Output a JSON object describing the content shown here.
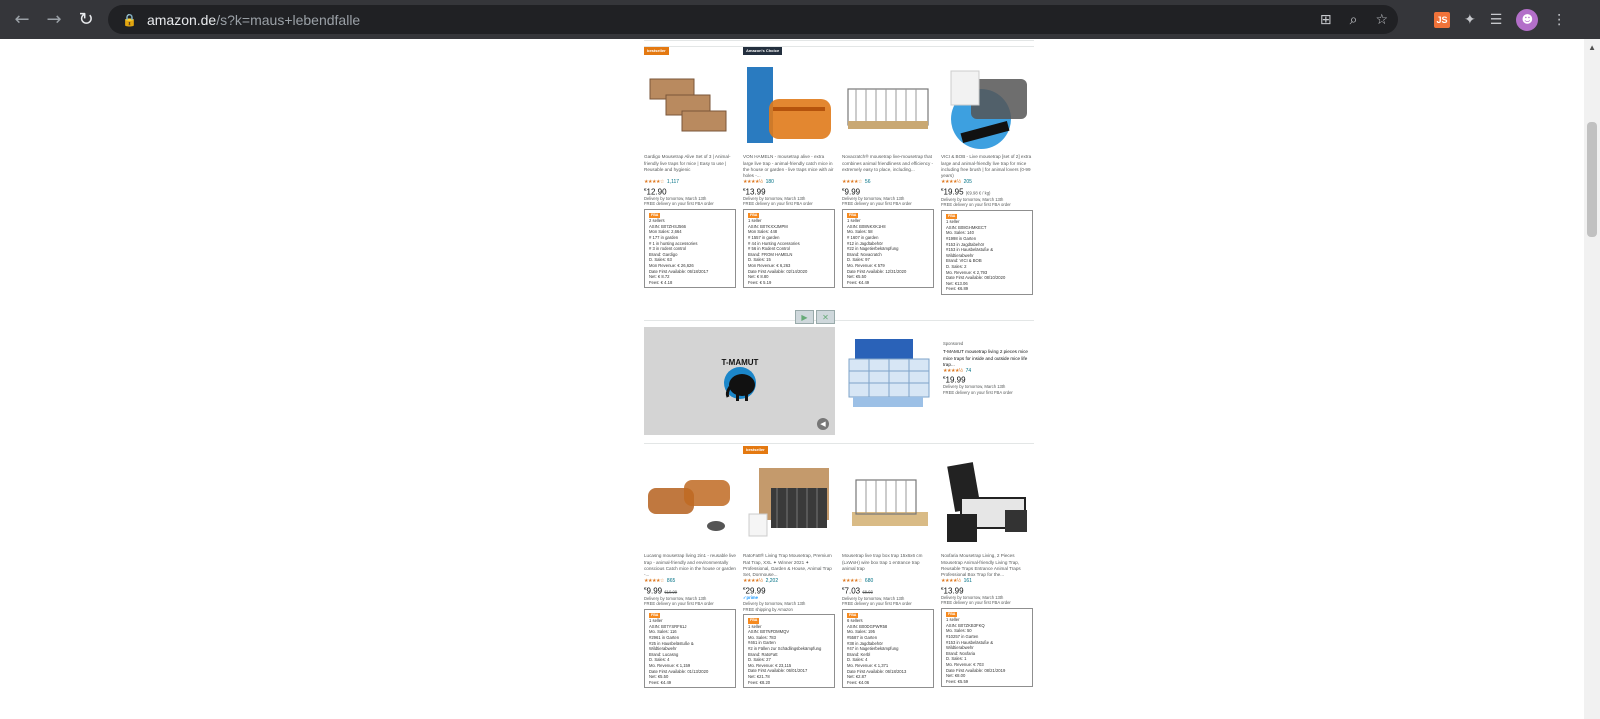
{
  "browser": {
    "url_host": "amazon.de",
    "url_rest": "/s?k=maus+lebendfalle",
    "ext_js_label": "JS"
  },
  "row1": [
    {
      "badge": "bestseller",
      "title": "Gardigo Mousetrap Alive Set of 3 | Animal-friendly live traps for mice | Easy to use | Reusable and hygienic",
      "stars": "★★★★☆",
      "rating_count": "1,117",
      "price": "12.90",
      "delivery": "Delivery by tomorrow, March 13th",
      "delivery2": "FREE delivery on your first FBA order",
      "info_tag": "FBA",
      "info": [
        "2 sellers",
        "ASIN: B07ZHSJ566",
        "Mon Sales: 2,664",
        "# 177 in garden",
        "# 1 in hunting accessories",
        "# 3 in rodent control",
        "Brand: Gardigo",
        "D. Sales: 63",
        "Mon Revenue: € 26,626",
        "Date First Available: 06/18/2017",
        "Net: € 8.72",
        "Fees: € 4.18"
      ]
    },
    {
      "badge": "Amazon's Choice",
      "title": "VON HAMELN - mousetrap alive - extra large live trap - animal-friendly catch mice in the house or garden - live traps mice with air holes -...",
      "stars": "★★★★½",
      "rating_count": "180",
      "price": "13.99",
      "delivery": "Delivery by tomorrow, March 13th",
      "delivery2": "FREE delivery on your first FBA order",
      "info_tag": "FBA",
      "info": [
        "1 seller",
        "ASIN: B07KXXJMPM",
        "Mon Sales: 448",
        "# 1557 in garden",
        "# 44 in Hunting Accessories",
        "# 56 in Rodent Control",
        "Brand: FROM HAMELN",
        "D. Sales: 15",
        "Mon Revenue: € 6,263",
        "Date First Available: 02/14/2020",
        "Net: € 8.80",
        "Fees: € 5.19"
      ]
    },
    {
      "badge": "",
      "title": "Novacratch® mousetrap live-mousetrap that combines animal friendliness and efficiency - extremely easy to place, including...",
      "stars": "★★★★☆",
      "rating_count": "56",
      "price": "9.99",
      "delivery": "Delivery by tomorrow, March 13th",
      "delivery2": "FREE delivery on your first FBA order",
      "info_tag": "FBA",
      "info": [
        "1 seller",
        "ASIN: B08NKXK1H8",
        "Mo. Sales: 58",
        "# 1607 in garden",
        "#12 in Jagdtabehör",
        "#22 in Nagetierbekämpfung",
        "Brand: Novacratch",
        "D. Sales: 97",
        "Mo. Revenue: € 579",
        "Date First Available: 12/31/2020",
        "Net: €5.50",
        "Fees: €4.49"
      ]
    },
    {
      "badge": "",
      "title": "VICI & BOB - Live mousetrap [set of 2] extra large and animal-friendly live trap for mice including free brush | for animal lovers (0-99 years)",
      "stars": "★★★★½",
      "rating_count": "205",
      "price": "19.95",
      "price_unit": "(€9.98 € / kg)",
      "delivery": "Delivery by tomorrow, March 13th",
      "delivery2": "FREE delivery on your first FBA order",
      "info_tag": "FBA",
      "info": [
        "1 seller",
        "ASIN: B08GHMKECT",
        "Mo. Sales: 140",
        "#1998 in Garten",
        "#153 in Jagdtabehör",
        "#153 in Hausbelästuße &",
        "Wildtierabwehr",
        "Brand: VICI & BOB",
        "D. Sales: 2",
        "Mo. Revenue: € 2,793",
        "Date First Available: 08/10/2020",
        "Net: €13.06",
        "Fees: €6.89"
      ]
    }
  ],
  "sponsored": {
    "brand_logo": "T-MAMUT",
    "label": "Sponsored",
    "title": "T-MAMUT mousetrap living 2 pieces mice mice traps for inside and outside mice life trap...",
    "stars": "★★★★½",
    "rating_count": "74",
    "price": "19.99",
    "delivery": "Delivery by tomorrow, March 13th",
    "delivery2": "FREE delivery on your first FBA order"
  },
  "row2": [
    {
      "badge": "",
      "title": "Lucasng mousetrap living 2in1 - reusable live trap - animal-friendly and environmentally conscious Catch mice in the house or garden -...",
      "stars": "★★★★☆",
      "rating_count": "865",
      "price": "9.99",
      "price_old": "€10.99",
      "delivery": "Delivery by tomorrow, March 13th",
      "delivery2": "FREE delivery on your first FBA order",
      "info_tag": "FBA",
      "info": [
        "1 seller",
        "ASIN: B07YSRF61J",
        "Mo. Sales: 116",
        "#2961 in Garten",
        "#25 in Hausbelästuße &",
        "Wildtierabwehr",
        "Brand: Lucasng",
        "D. Sales: 4",
        "Mo. Revenue: € 1,159",
        "Date First Available: 01/13/2020",
        "Net: €5.50",
        "Fees: €4.49"
      ]
    },
    {
      "badge": "bestseller",
      "title": "RatoFatt® Living Trap Mousetrap, Premium Rat Trap, XXL ✦ Winner 2021 ✦ Professional, Garden & House, Animal Trap Set, Dormouse...",
      "stars": "★★★★½",
      "rating_count": "2,202",
      "price": "29.99",
      "prime": "✓prime",
      "delivery": "Delivery by tomorrow, March 13th",
      "delivery2": "FREE shipping by Amazon",
      "info_tag": "FBA",
      "info": [
        "1 seller",
        "ASIN: B07NFDMMQV",
        "Mo. Sales: 783",
        "#461 in Garten",
        "#2 in Fällen zur Schädlingsbekämpfung",
        "Brand: RatoFatt",
        "D. Sales: 27",
        "Mo. Revenue: € 23,115",
        "Date First Available: 06/01/2017",
        "Net: €21.78",
        "Fees: €8.20"
      ]
    },
    {
      "badge": "",
      "title": "Mousetrap live trap box trap 15x6x6 cm (LxWxH) wire box trap 1 entrance trap animal trap",
      "stars": "★★★★☆",
      "rating_count": "680",
      "price": "7.03",
      "price_old": "€8.03",
      "delivery": "Delivery by tomorrow, March 13th",
      "delivery2": "FREE delivery on your first FBA order",
      "info_tag": "FBA",
      "info": [
        "6 sellers",
        "ASIN: B00DGPWR58",
        "Mo. Sales: 195",
        "#5587 in Garten",
        "#38 in Jagdtabehör",
        "#47 in Nagetierbekämpfung",
        "Brand: Kerbl",
        "D. Sales: 4",
        "Mo. Revenue: € 1,371",
        "Date First Available: 06/18/2013",
        "Net: €2.87",
        "Fees: €4.06"
      ]
    },
    {
      "badge": "",
      "title": "Noxfaria Mousetrap Living, 2 Pieces Mousetrap Animal-friendly Living Trap, Reusable Traps Entrance Animal Traps Professional Box Trap for the...",
      "stars": "★★★★½",
      "rating_count": "161",
      "price": "13.99",
      "delivery": "Delivery by tomorrow, March 13th",
      "delivery2": "FREE delivery on your first FBA order",
      "info_tag": "FBA",
      "info": [
        "1 seller",
        "ASIN: B07ZKB3FKQ",
        "Mo. Sales: 50",
        "#10257 in Garten",
        "#153 in Hausbelästuße &",
        "Wildtierabwehr",
        "Brand: Noxfaria",
        "D. Sales: 1",
        "Mo. Revenue: € 703",
        "Date First Available: 08/21/2019",
        "Net: €8.00",
        "Fees: €5.59"
      ]
    }
  ]
}
